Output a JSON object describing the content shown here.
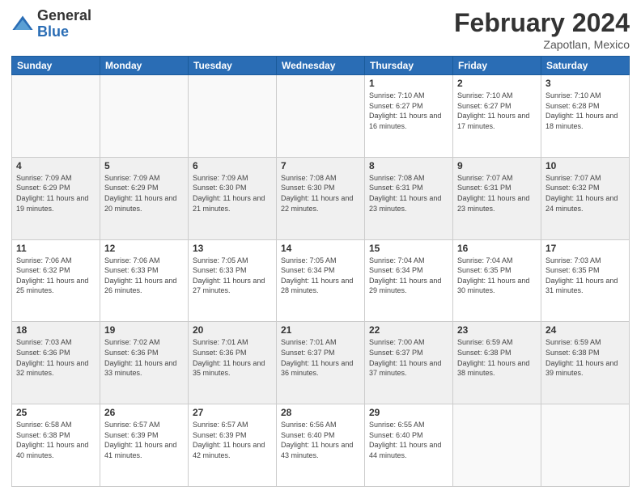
{
  "logo": {
    "general": "General",
    "blue": "Blue"
  },
  "header": {
    "month": "February 2024",
    "location": "Zapotlan, Mexico"
  },
  "weekdays": [
    "Sunday",
    "Monday",
    "Tuesday",
    "Wednesday",
    "Thursday",
    "Friday",
    "Saturday"
  ],
  "weeks": [
    [
      {
        "day": "",
        "info": ""
      },
      {
        "day": "",
        "info": ""
      },
      {
        "day": "",
        "info": ""
      },
      {
        "day": "",
        "info": ""
      },
      {
        "day": "1",
        "info": "Sunrise: 7:10 AM\nSunset: 6:27 PM\nDaylight: 11 hours and 16 minutes."
      },
      {
        "day": "2",
        "info": "Sunrise: 7:10 AM\nSunset: 6:27 PM\nDaylight: 11 hours and 17 minutes."
      },
      {
        "day": "3",
        "info": "Sunrise: 7:10 AM\nSunset: 6:28 PM\nDaylight: 11 hours and 18 minutes."
      }
    ],
    [
      {
        "day": "4",
        "info": "Sunrise: 7:09 AM\nSunset: 6:29 PM\nDaylight: 11 hours and 19 minutes."
      },
      {
        "day": "5",
        "info": "Sunrise: 7:09 AM\nSunset: 6:29 PM\nDaylight: 11 hours and 20 minutes."
      },
      {
        "day": "6",
        "info": "Sunrise: 7:09 AM\nSunset: 6:30 PM\nDaylight: 11 hours and 21 minutes."
      },
      {
        "day": "7",
        "info": "Sunrise: 7:08 AM\nSunset: 6:30 PM\nDaylight: 11 hours and 22 minutes."
      },
      {
        "day": "8",
        "info": "Sunrise: 7:08 AM\nSunset: 6:31 PM\nDaylight: 11 hours and 23 minutes."
      },
      {
        "day": "9",
        "info": "Sunrise: 7:07 AM\nSunset: 6:31 PM\nDaylight: 11 hours and 23 minutes."
      },
      {
        "day": "10",
        "info": "Sunrise: 7:07 AM\nSunset: 6:32 PM\nDaylight: 11 hours and 24 minutes."
      }
    ],
    [
      {
        "day": "11",
        "info": "Sunrise: 7:06 AM\nSunset: 6:32 PM\nDaylight: 11 hours and 25 minutes."
      },
      {
        "day": "12",
        "info": "Sunrise: 7:06 AM\nSunset: 6:33 PM\nDaylight: 11 hours and 26 minutes."
      },
      {
        "day": "13",
        "info": "Sunrise: 7:05 AM\nSunset: 6:33 PM\nDaylight: 11 hours and 27 minutes."
      },
      {
        "day": "14",
        "info": "Sunrise: 7:05 AM\nSunset: 6:34 PM\nDaylight: 11 hours and 28 minutes."
      },
      {
        "day": "15",
        "info": "Sunrise: 7:04 AM\nSunset: 6:34 PM\nDaylight: 11 hours and 29 minutes."
      },
      {
        "day": "16",
        "info": "Sunrise: 7:04 AM\nSunset: 6:35 PM\nDaylight: 11 hours and 30 minutes."
      },
      {
        "day": "17",
        "info": "Sunrise: 7:03 AM\nSunset: 6:35 PM\nDaylight: 11 hours and 31 minutes."
      }
    ],
    [
      {
        "day": "18",
        "info": "Sunrise: 7:03 AM\nSunset: 6:36 PM\nDaylight: 11 hours and 32 minutes."
      },
      {
        "day": "19",
        "info": "Sunrise: 7:02 AM\nSunset: 6:36 PM\nDaylight: 11 hours and 33 minutes."
      },
      {
        "day": "20",
        "info": "Sunrise: 7:01 AM\nSunset: 6:36 PM\nDaylight: 11 hours and 35 minutes."
      },
      {
        "day": "21",
        "info": "Sunrise: 7:01 AM\nSunset: 6:37 PM\nDaylight: 11 hours and 36 minutes."
      },
      {
        "day": "22",
        "info": "Sunrise: 7:00 AM\nSunset: 6:37 PM\nDaylight: 11 hours and 37 minutes."
      },
      {
        "day": "23",
        "info": "Sunrise: 6:59 AM\nSunset: 6:38 PM\nDaylight: 11 hours and 38 minutes."
      },
      {
        "day": "24",
        "info": "Sunrise: 6:59 AM\nSunset: 6:38 PM\nDaylight: 11 hours and 39 minutes."
      }
    ],
    [
      {
        "day": "25",
        "info": "Sunrise: 6:58 AM\nSunset: 6:38 PM\nDaylight: 11 hours and 40 minutes."
      },
      {
        "day": "26",
        "info": "Sunrise: 6:57 AM\nSunset: 6:39 PM\nDaylight: 11 hours and 41 minutes."
      },
      {
        "day": "27",
        "info": "Sunrise: 6:57 AM\nSunset: 6:39 PM\nDaylight: 11 hours and 42 minutes."
      },
      {
        "day": "28",
        "info": "Sunrise: 6:56 AM\nSunset: 6:40 PM\nDaylight: 11 hours and 43 minutes."
      },
      {
        "day": "29",
        "info": "Sunrise: 6:55 AM\nSunset: 6:40 PM\nDaylight: 11 hours and 44 minutes."
      },
      {
        "day": "",
        "info": ""
      },
      {
        "day": "",
        "info": ""
      }
    ]
  ]
}
